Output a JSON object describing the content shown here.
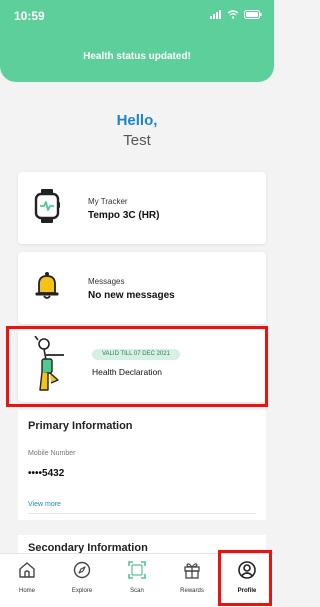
{
  "status_bar": {
    "time": "10:59"
  },
  "banner": {
    "text": "Health status updated!"
  },
  "greeting": {
    "hello": "Hello,",
    "name": "Test"
  },
  "tracker_card": {
    "label": "My Tracker",
    "value": "Tempo 3C (HR)",
    "icon": "smartwatch-icon"
  },
  "messages_card": {
    "label": "Messages",
    "value": "No new messages",
    "icon": "bell-icon"
  },
  "health_card": {
    "badge": "VALID TILL 07 DEC 2021",
    "title": "Health Declaration",
    "icon": "person-figure-icon"
  },
  "primary_info": {
    "title": "Primary Information",
    "mobile_label": "Mobile Number",
    "mobile_value": "••••5432",
    "view_more": "View more"
  },
  "secondary_info": {
    "title": "Secondary Information"
  },
  "tabs": [
    {
      "label": "Home",
      "icon": "home-icon"
    },
    {
      "label": "Explore",
      "icon": "compass-icon"
    },
    {
      "label": "Scan",
      "icon": "scan-icon"
    },
    {
      "label": "Rewards",
      "icon": "gift-icon"
    },
    {
      "label": "Profile",
      "icon": "profile-icon",
      "active": true
    }
  ],
  "colors": {
    "brand_green": "#5ccf9a",
    "link_blue": "#1d86c9",
    "highlight_red": "#ee1111"
  }
}
